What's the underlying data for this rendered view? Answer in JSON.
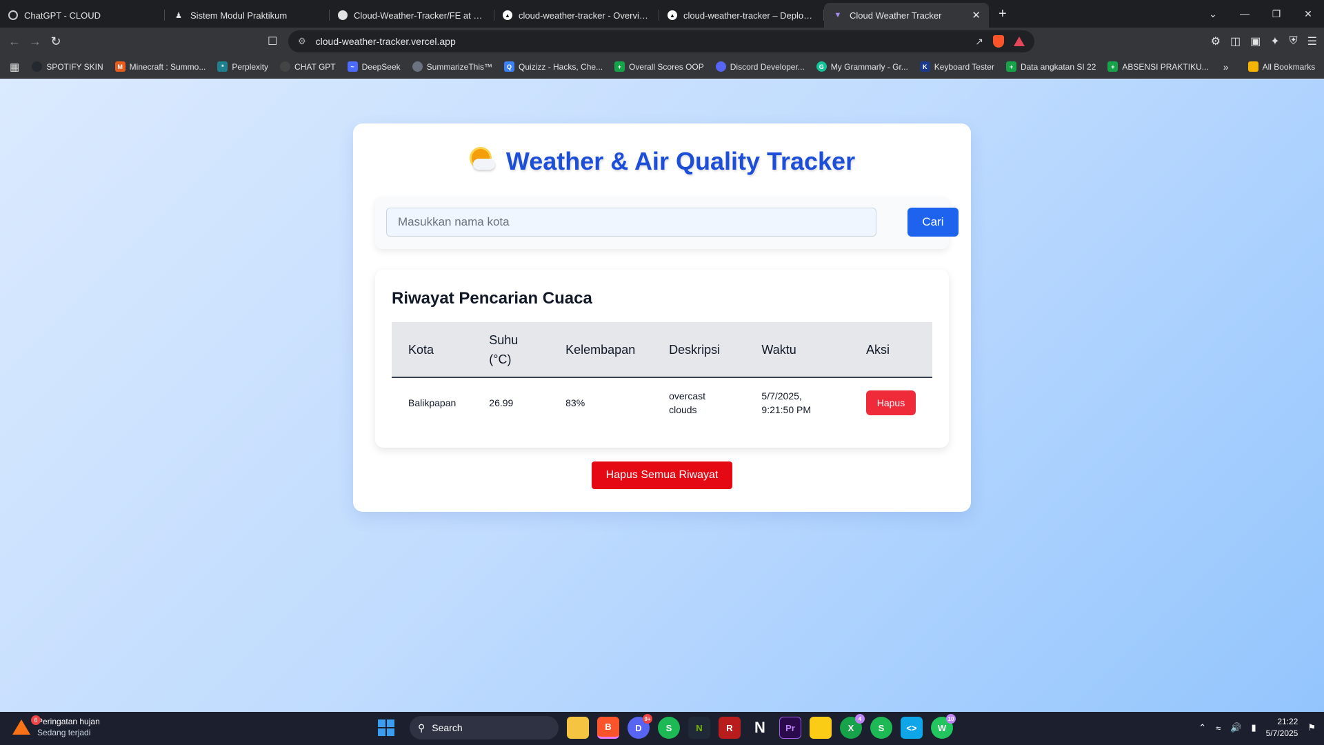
{
  "browser": {
    "tabs": [
      {
        "title": "ChatGPT - CLOUD",
        "icon": "chatgpt-icon",
        "active": false
      },
      {
        "title": "Sistem Modul Praktikum",
        "icon": "user-icon",
        "active": false
      },
      {
        "title": "Cloud-Weather-Tracker/FE at main",
        "icon": "github-icon",
        "active": false
      },
      {
        "title": "cloud-weather-tracker - Overview -",
        "icon": "vercel-icon",
        "active": false
      },
      {
        "title": "cloud-weather-tracker – Deploymen",
        "icon": "vercel-icon",
        "active": false
      },
      {
        "title": "Cloud Weather Tracker",
        "icon": "vite-icon",
        "active": true
      }
    ],
    "url": "cloud-weather-tracker.vercel.app",
    "bookmarks": [
      {
        "label": "SPOTIFY SKIN",
        "icon": "github-icon",
        "color": "#24292f"
      },
      {
        "label": "Minecraft : Summo...",
        "icon": "minecraft-icon",
        "color": "#e85d1f"
      },
      {
        "label": "Perplexity",
        "icon": "perplexity-icon",
        "color": "#20808d"
      },
      {
        "label": "CHAT GPT",
        "icon": "chatgpt-icon",
        "color": "#444444"
      },
      {
        "label": "DeepSeek",
        "icon": "deepseek-icon",
        "color": "#4d6bfe"
      },
      {
        "label": "SummarizeThis™",
        "icon": "summarize-icon",
        "color": "#6b7280"
      },
      {
        "label": "Quizizz - Hacks, Che...",
        "icon": "quizizz-icon",
        "color": "#3b82f6"
      },
      {
        "label": "Overall Scores OOP",
        "icon": "sheets-icon",
        "color": "#16a34a"
      },
      {
        "label": "Discord Developer...",
        "icon": "discord-icon",
        "color": "#5865f2"
      },
      {
        "label": "My Grammarly - Gr...",
        "icon": "grammarly-icon",
        "color": "#15c39a"
      },
      {
        "label": "Keyboard Tester",
        "icon": "keyboard-icon",
        "color": "#1e3a8a"
      },
      {
        "label": "Data angkatan SI 22",
        "icon": "sheets-icon",
        "color": "#16a34a"
      },
      {
        "label": "ABSENSI PRAKTIKU...",
        "icon": "sheets-icon",
        "color": "#16a34a"
      }
    ],
    "all_bookmarks_label": "All Bookmarks"
  },
  "app": {
    "title": "Weather & Air Quality Tracker",
    "title_icon": "sun-behind-cloud-icon",
    "search": {
      "placeholder": "Masukkan nama kota",
      "value": "",
      "button_label": "Cari"
    },
    "history": {
      "title": "Riwayat Pencarian Cuaca",
      "columns": [
        "Kota",
        "Suhu (°C)",
        "Kelembapan",
        "Deskripsi",
        "Waktu",
        "Aksi"
      ],
      "rows": [
        {
          "kota": "Balikpapan",
          "suhu": "26.99",
          "kelembapan": "83%",
          "deskripsi": "overcast clouds",
          "waktu": "5/7/2025, 9:21:50 PM",
          "aksi_label": "Hapus"
        }
      ]
    },
    "clear_all_label": "Hapus Semua Riwayat"
  },
  "taskbar": {
    "weather_title": "Peringatan hujan",
    "weather_sub": "Sedang terjadi",
    "weather_badge": "6",
    "search_label": "Search",
    "discord_badge": "9+",
    "xbox_badge": "4",
    "whatsapp_badge": "10",
    "time": "21:22",
    "date": "5/7/2025"
  },
  "colors": {
    "title": "#1d4ed8",
    "primary_button": "#1d63ed",
    "danger_button": "#e50914"
  }
}
